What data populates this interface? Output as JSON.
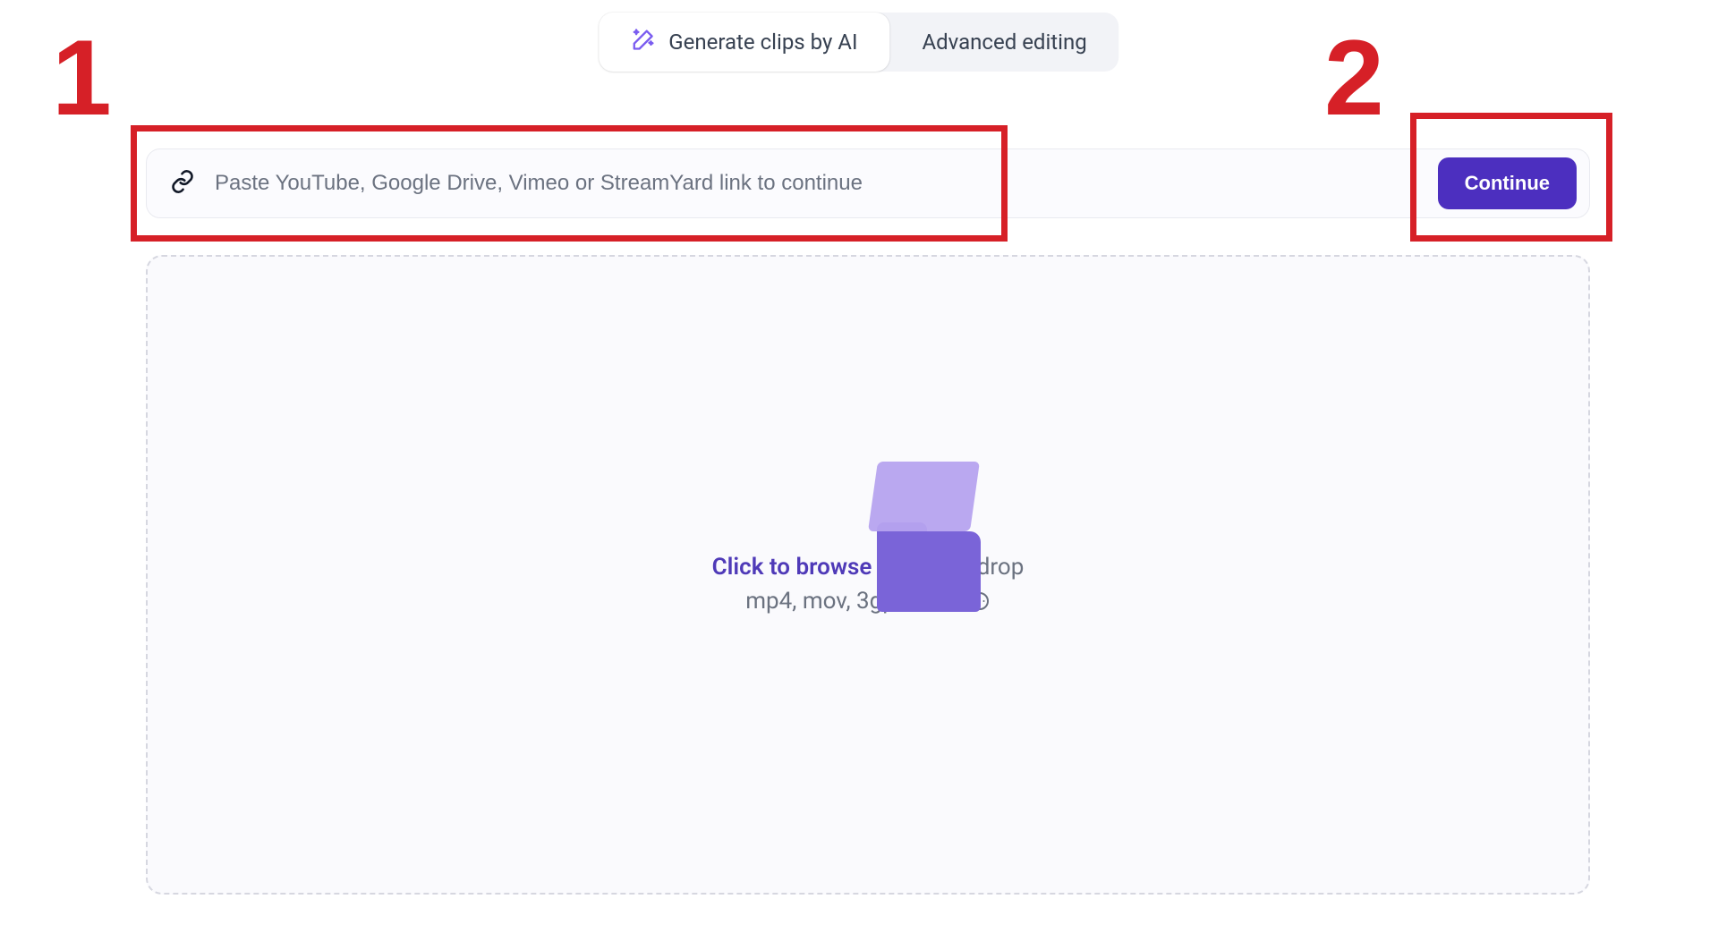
{
  "tabs": {
    "generate": "Generate clips by AI",
    "advanced": "Advanced editing"
  },
  "url_row": {
    "placeholder": "Paste YouTube, Google Drive, Vimeo or StreamYard link to continue",
    "continue_label": "Continue"
  },
  "dropzone": {
    "browse_label": "Click to browse",
    "drag_label": " or drag & drop",
    "formats_label": "mp4, mov, 3gp or avi"
  },
  "annotations": {
    "one": "1",
    "two": "2"
  }
}
